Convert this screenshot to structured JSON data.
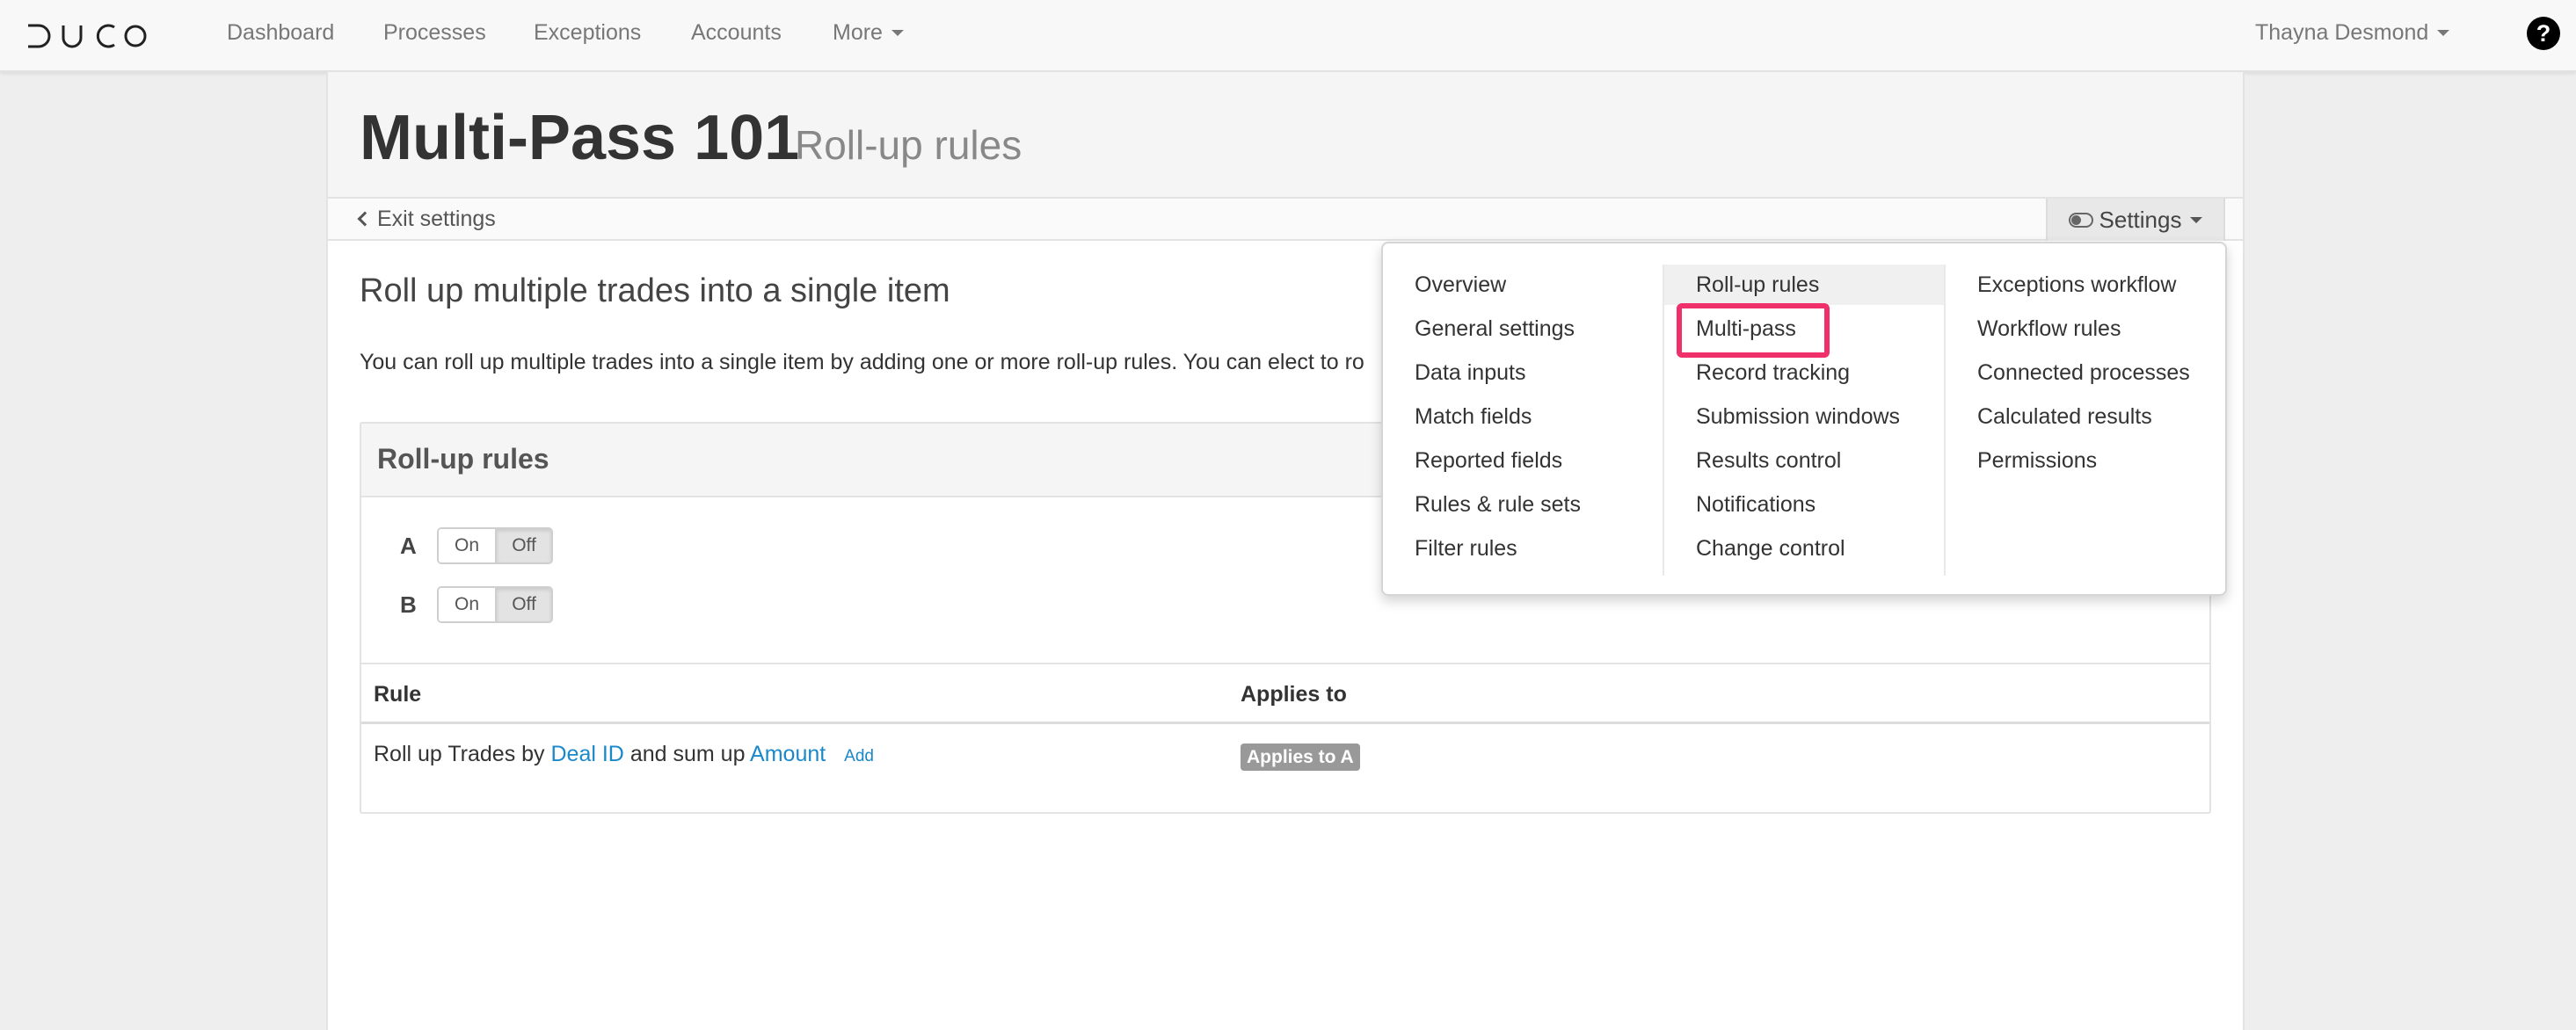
{
  "nav": {
    "logo_text": "DUCO",
    "items": [
      "Dashboard",
      "Processes",
      "Exceptions",
      "Accounts"
    ],
    "more_label": "More",
    "user_name": "Thayna Desmond",
    "help_label": "?"
  },
  "header": {
    "title": "Multi-Pass 101",
    "subtitle": "Roll-up rules"
  },
  "subbar": {
    "exit_label": "Exit settings",
    "settings_label": "Settings"
  },
  "content": {
    "heading": "Roll up multiple trades into a single item",
    "intro": "You can roll up multiple trades into a single item by adding one or more roll-up rules. You can elect to ro"
  },
  "panel": {
    "title": "Roll-up rules",
    "switches": [
      {
        "label": "A",
        "on": "On",
        "off": "Off",
        "selected": "Off"
      },
      {
        "label": "B",
        "on": "On",
        "off": "Off",
        "selected": "Off"
      }
    ],
    "columns": [
      "Rule",
      "Applies to"
    ],
    "row": {
      "prefix": "Roll up Trades by",
      "field1": "Deal ID",
      "middle": "and sum up",
      "field2": "Amount",
      "add": "Add",
      "applies": "Applies to A"
    }
  },
  "menu": {
    "col1": [
      "Overview",
      "General settings",
      "Data inputs",
      "Match fields",
      "Reported fields",
      "Rules & rule sets",
      "Filter rules"
    ],
    "col2": [
      "Roll-up rules",
      "Multi-pass",
      "Record tracking",
      "Submission windows",
      "Results control",
      "Notifications",
      "Change control"
    ],
    "col3": [
      "Exceptions workflow",
      "Workflow rules",
      "Connected processes",
      "Calculated results",
      "Permissions"
    ],
    "active": "Roll-up rules",
    "highlighted": "Multi-pass",
    "highlight_color": "#f0306b"
  },
  "colors": {
    "link": "#1a88c9",
    "badge": "#999999"
  }
}
